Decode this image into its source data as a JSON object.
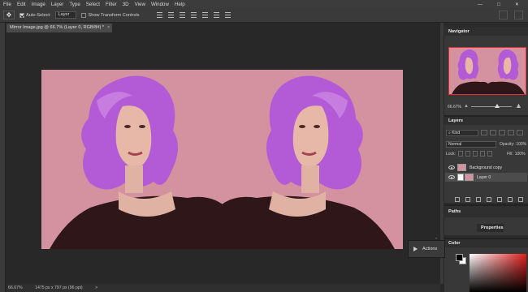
{
  "menu": [
    "File",
    "Edit",
    "Image",
    "Layer",
    "Type",
    "Select",
    "Filter",
    "3D",
    "View",
    "Window",
    "Help"
  ],
  "window_controls": {
    "minimize": "—",
    "maximize": "□",
    "close": "✕"
  },
  "options_bar": {
    "tool_icon": "move-tool-icon",
    "auto_select_label": "Auto-Select:",
    "auto_select_checked": true,
    "auto_select_target": "Layer",
    "transform_controls_label": "Show Transform Controls",
    "transform_controls_checked": false
  },
  "document": {
    "tab_title": "Mirror Image.jpg @ 66.7% (Layer 0, RGB/8#) *",
    "tab_close": "×",
    "background_color": "#d4919f",
    "hair_color": "#b35ad6"
  },
  "status_bar": {
    "zoom": "66.67%",
    "doc_size": "1475 px x 797 px (96 ppi)",
    "arrow": ">"
  },
  "actions_panel": {
    "title": "Actions",
    "collapse": "»"
  },
  "navigator": {
    "title": "Navigator",
    "zoom": "66.67%",
    "frame_color": "#e03030"
  },
  "layers_panel": {
    "title": "Layers",
    "filter_kind": "Kind",
    "blend_mode": "Normal",
    "opacity_label": "Opacity:",
    "opacity_value": "100%",
    "lock_label": "Lock:",
    "fill_label": "Fill:",
    "fill_value": "100%",
    "layers": [
      {
        "name": "Background copy",
        "visible": true,
        "selected": false
      },
      {
        "name": "Layer 0",
        "visible": true,
        "selected": true
      }
    ]
  },
  "paths_panel": {
    "title": "Paths"
  },
  "properties_panel": {
    "title": "Properties"
  },
  "color_panel": {
    "title": "Color",
    "foreground": "#000000",
    "background": "#ffffff",
    "hue": "#e01e1e"
  }
}
